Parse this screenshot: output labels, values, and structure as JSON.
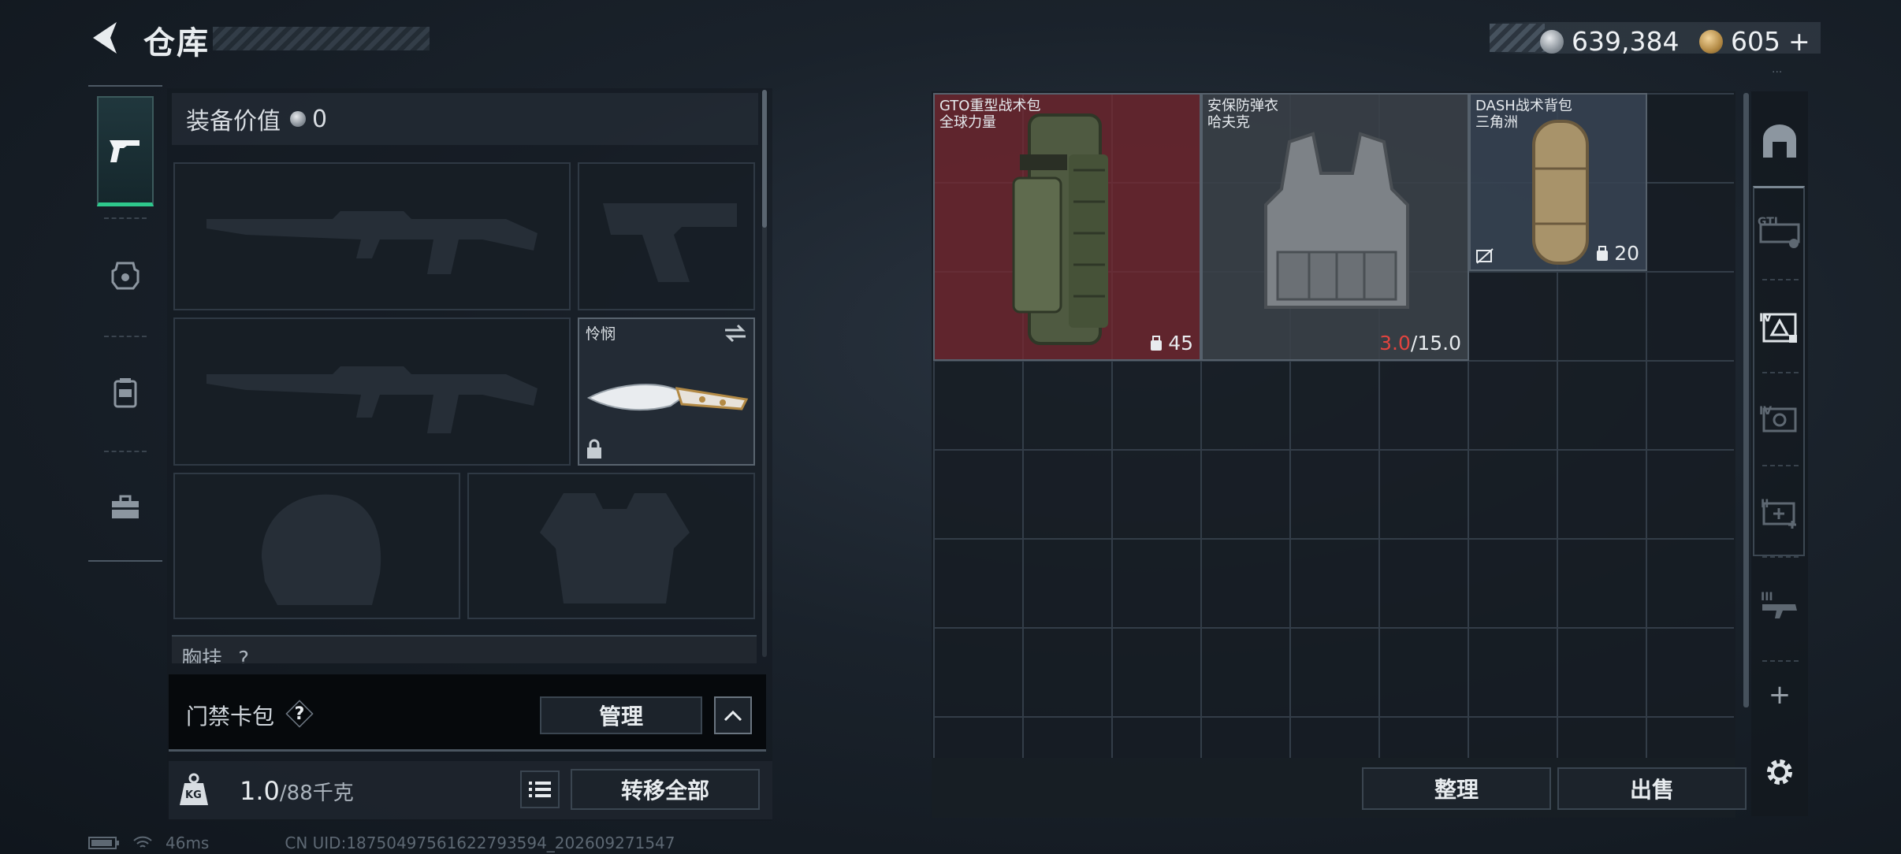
{
  "header": {
    "title": "仓库",
    "currency": {
      "silver": "639,384",
      "gold": "605"
    },
    "add_label": "+",
    "mini_text": "..."
  },
  "left_rail": {
    "items": [
      {
        "name": "weapons",
        "icon": "pistol-icon",
        "active": true
      },
      {
        "name": "armor",
        "icon": "helmet-icon",
        "active": false
      },
      {
        "name": "backpack",
        "icon": "backpack-icon",
        "active": false
      },
      {
        "name": "toolbox",
        "icon": "toolbox-icon",
        "active": false
      }
    ]
  },
  "loadout": {
    "value_label": "装备价值",
    "value": "0",
    "melee_name": "怜悯",
    "chest_label": "胸挂",
    "chest_help": "?"
  },
  "keycard": {
    "label": "门禁卡包",
    "help": "?",
    "manage_label": "管理"
  },
  "weight": {
    "current": "1.0",
    "max": "/88",
    "unit": "千克",
    "icon_label": "KG",
    "transfer_label": "转移全部"
  },
  "stash": {
    "items": [
      {
        "title": "GTO重型战术包",
        "subtitle": "全球力量",
        "capacity": "45"
      },
      {
        "title": "安保防弹衣",
        "subtitle": "哈夫克",
        "durability_current": "3.0",
        "durability_max": "/15.0"
      },
      {
        "title": "DASH战术背包",
        "subtitle": "三角洲",
        "capacity": "20"
      }
    ],
    "sort_label": "整理",
    "sell_label": "出售"
  },
  "right_rail": {
    "items": [
      "GTI",
      "IV",
      "IV",
      "II",
      "III"
    ],
    "add_label": "+"
  },
  "status": {
    "ping": "46ms",
    "uid": "CN UID:18750497561622793594_202609271547"
  },
  "colors": {
    "accent_green": "#2ec88c",
    "durability_red": "#e0443f",
    "bag_bg": "#782830"
  }
}
